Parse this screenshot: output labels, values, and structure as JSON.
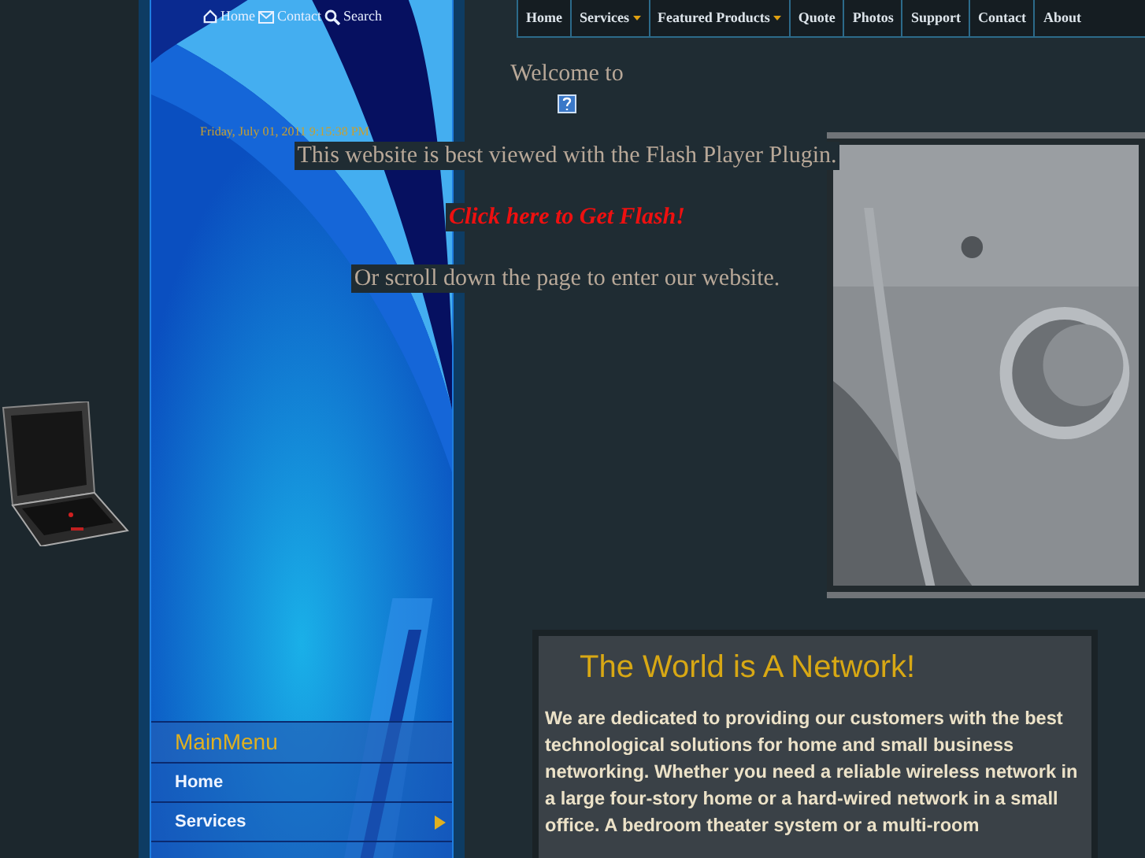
{
  "top_links": [
    {
      "label": "Home",
      "kind": "home"
    },
    {
      "label": "Contact",
      "kind": "mail"
    },
    {
      "label": "Search",
      "kind": "search"
    }
  ],
  "date": "Friday, July 01, 2011 9:15:38 PM",
  "nav": [
    {
      "label": "Home",
      "dropdown": false
    },
    {
      "label": "Services",
      "dropdown": true
    },
    {
      "label": "Featured Products",
      "dropdown": true
    },
    {
      "label": "Quote",
      "dropdown": false
    },
    {
      "label": "Photos",
      "dropdown": false
    },
    {
      "label": "Support",
      "dropdown": false
    },
    {
      "label": "Contact",
      "dropdown": false
    },
    {
      "label": "About",
      "dropdown": false
    }
  ],
  "flash_notice": {
    "welcome": "Welcome to",
    "message": "This website is best viewed with the Flash Player Plugin.",
    "link": "Click here to Get Flash!",
    "scroll_hint": "Or scroll down the page to enter our website."
  },
  "main_menu": {
    "title": "MainMenu",
    "items": [
      {
        "label": "Home",
        "submenu": false
      },
      {
        "label": "Services",
        "submenu": true
      }
    ]
  },
  "content": {
    "heading": "The World is A Network!",
    "paragraph": "We are dedicated to providing our customers with the best technological solutions for home and small business networking. Whether you need a reliable wireless network in a large four-story home or a hard-wired network in a small office. A bedroom theater system or a multi-room"
  }
}
